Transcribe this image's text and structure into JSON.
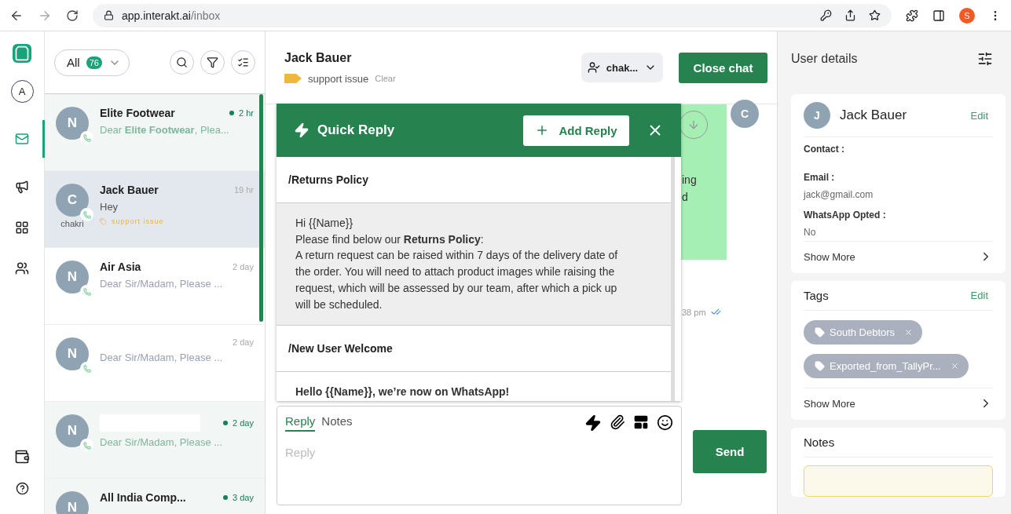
{
  "browser": {
    "host": "app.interakt.ai",
    "path": "/inbox",
    "profile": "S"
  },
  "nav": [
    {
      "kind": "avatar",
      "label": "A",
      "selected": false
    },
    {
      "kind": "mail",
      "selected": true
    },
    {
      "kind": "campaign",
      "selected": false
    },
    {
      "kind": "grid",
      "selected": false
    },
    {
      "kind": "contacts",
      "selected": false
    }
  ],
  "list_header": {
    "filter": "All",
    "count": "76"
  },
  "conversations": [
    {
      "avatar": "N",
      "name": "Elite Footwear",
      "preview": "Dear **Elite Footwear**, Plea...",
      "time": "2 hr",
      "unread": true,
      "selected": false,
      "redacted": false,
      "whatsapp": true
    },
    {
      "avatar": "C",
      "name": "Jack Bauer",
      "preview": "Hey",
      "time": "19 hr",
      "unread": false,
      "selected": true,
      "redacted": false,
      "whatsapp": true,
      "agent": "chakri",
      "tag": "support issue"
    },
    {
      "avatar": "N",
      "name": "Air Asia",
      "preview": "Dear Sir/Madam, Please ...",
      "time": "2 day",
      "unread": false,
      "selected": false,
      "redacted": false,
      "whatsapp": true
    },
    {
      "avatar": "N",
      "preview": "Dear Sir/Madam, Please ...",
      "time": "2 day",
      "unread": false,
      "selected": false,
      "redacted": false,
      "whatsapp": true
    },
    {
      "avatar": "N",
      "preview": "Dear Sir/Madam, Please ...",
      "time": "2 day",
      "unread": true,
      "selected": false,
      "redacted": true,
      "whatsapp": true
    },
    {
      "avatar": "N",
      "name": "All India Comp...",
      "time": "3 day",
      "unread": true,
      "selected": false,
      "redacted": false,
      "whatsapp": false
    }
  ],
  "chat": {
    "title": "Jack Bauer",
    "tag": "support issue",
    "clear": "Clear",
    "agent": "chak...",
    "close": "Close chat",
    "message": {
      "lines": [
        "ing",
        "d"
      ],
      "time": "38 pm",
      "avatar": "C"
    }
  },
  "quick_reply": {
    "title": "Quick Reply",
    "add": "Add Reply",
    "replies": [
      {
        "title": "/Returns Policy",
        "highlighted": true,
        "body": [
          "Hi {{Name}}",
          "Please find below our **Returns Policy**:",
          "A return request can be raised within 7 days of the delivery date of the order. You will need to attach product images while raising the request, which will be assessed by our team, after which a pick up will be scheduled."
        ]
      },
      {
        "title": "/New User Welcome",
        "highlighted": false,
        "body": [
          "**Hello {{Name}}, we’re now on WhatsApp!**"
        ]
      }
    ]
  },
  "composer": {
    "tabs": [
      {
        "label": "Reply",
        "selected": true
      },
      {
        "label": "Notes",
        "selected": false
      }
    ],
    "placeholder": "Reply",
    "send": "Send"
  },
  "details": {
    "title": "User details",
    "name": "Jack Bauer",
    "avatar": "J",
    "edit": "Edit",
    "fields": [
      {
        "label": "Contact :"
      },
      {
        "label": "Email :",
        "value": "jack@gmail.com"
      },
      {
        "label": "WhatsApp Opted :",
        "value": "No"
      }
    ],
    "show_more": "Show More",
    "tags_title": "Tags",
    "tags_edit": "Edit",
    "tags": [
      "South Debtors",
      "Exported_from_TallyPr..."
    ],
    "tags_show_more": "Show More",
    "notes_title": "Notes"
  }
}
